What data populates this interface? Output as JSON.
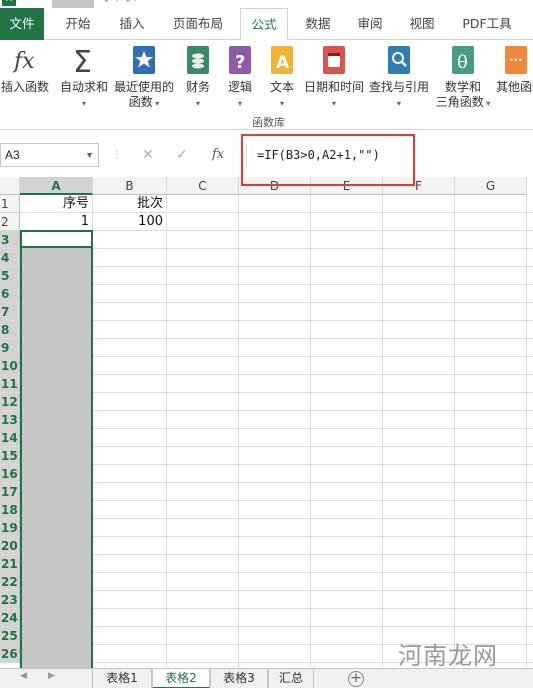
{
  "app": {
    "icon_label": "X",
    "undo_glyph": "↶ ·  ↷ ·"
  },
  "ribbon_tabs": [
    {
      "label": "文件"
    },
    {
      "label": "开始"
    },
    {
      "label": "插入"
    },
    {
      "label": "页面布局"
    },
    {
      "label": "公式",
      "active": true
    },
    {
      "label": "数据"
    },
    {
      "label": "审阅"
    },
    {
      "label": "视图"
    },
    {
      "label": "PDF工具"
    }
  ],
  "ribbon": {
    "buttons": [
      {
        "line1": "插入函数",
        "line2": "",
        "icon": "fx-icon"
      },
      {
        "line1": "自动求和",
        "line2": "",
        "icon": "sigma-icon"
      },
      {
        "line1": "最近使用的",
        "line2": "函数",
        "icon": "star-book-icon"
      },
      {
        "line1": "财务",
        "line2": "",
        "icon": "coins-book-icon"
      },
      {
        "line1": "逻辑",
        "line2": "",
        "icon": "question-book-icon"
      },
      {
        "line1": "文本",
        "line2": "",
        "icon": "text-book-icon"
      },
      {
        "line1": "日期和时间",
        "line2": "",
        "icon": "calendar-book-icon"
      },
      {
        "line1": "查找与引用",
        "line2": "",
        "icon": "search-book-icon"
      },
      {
        "line1": "数学和",
        "line2": "三角函数",
        "icon": "theta-book-icon"
      },
      {
        "line1": "其他函数",
        "line2": "",
        "icon": "more-book-icon"
      }
    ],
    "group_label": "函数库"
  },
  "formula_bar": {
    "name_box": "A3",
    "formula": "=IF(B3>0,A2+1,\"\")",
    "cancel_glyph": "✕",
    "enter_glyph": "✓",
    "fx_glyph": "fx"
  },
  "grid": {
    "columns": [
      "A",
      "B",
      "C",
      "D",
      "E",
      "F",
      "G"
    ],
    "selected_column": "A",
    "rows": [
      "1",
      "2",
      "3",
      "4",
      "5",
      "6",
      "7",
      "8",
      "9",
      "10",
      "11",
      "12",
      "13",
      "14",
      "15",
      "16",
      "17",
      "18",
      "19",
      "20",
      "21",
      "22",
      "23",
      "24",
      "25",
      "26"
    ],
    "selected_rows_from": 3,
    "cells": {
      "A1": "序号",
      "B1": "批次",
      "A2": "1",
      "B2": "100"
    }
  },
  "sheet_tabs": {
    "nav_left": "◀",
    "nav_right": "▶",
    "sheets": [
      {
        "label": "表格1"
      },
      {
        "label": "表格2",
        "active": true
      },
      {
        "label": "表格3"
      },
      {
        "label": "汇总"
      }
    ],
    "add_glyph": "+"
  },
  "watermark": "河南龙网",
  "colors": {
    "excel_green": "#217346",
    "highlight_red": "#e53935",
    "selection_gray": "#c6c6c6"
  }
}
